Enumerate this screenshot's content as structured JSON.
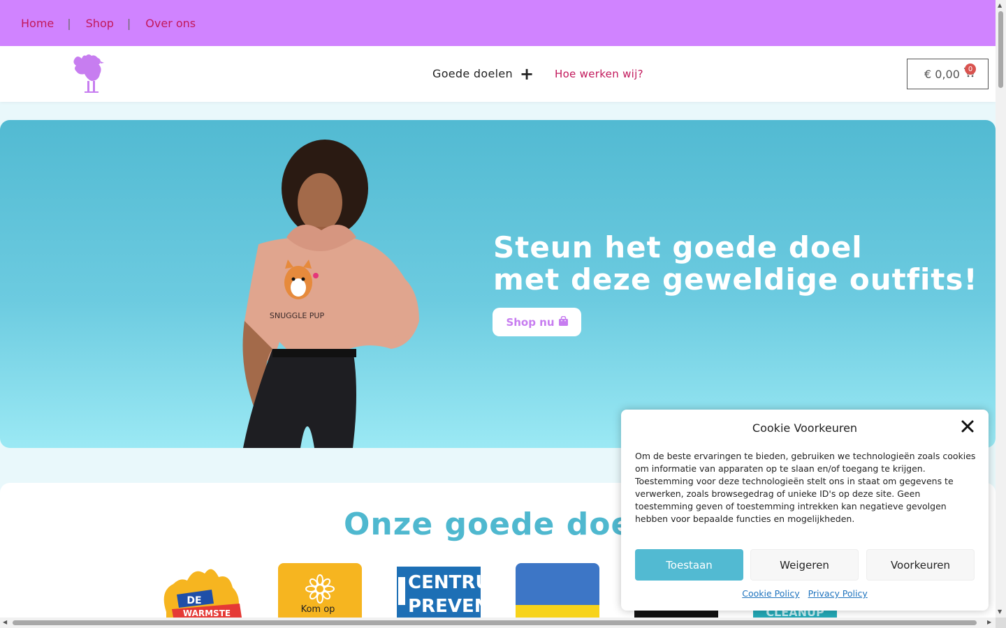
{
  "topbar": {
    "links": [
      {
        "label": "Home"
      },
      {
        "label": "Shop"
      },
      {
        "label": "Over ons"
      }
    ],
    "separator": "|",
    "background": "#d083ff",
    "link_color": "#c2185b"
  },
  "header": {
    "nav_goede_doelen": "Goede doelen",
    "nav_goede_doelen_icon": "plus-icon",
    "nav_hoe_werken": "Hoe werken wij?",
    "cart_total": "€ 0,00",
    "cart_count": "0",
    "cart_icon": "shopping-cart-icon"
  },
  "hero": {
    "title_line1": "Steun het goede doel",
    "title_line2": "met deze geweldige outfits!",
    "shop_button": "Shop nu",
    "shop_button_icon": "shopping-bag-icon",
    "hoodie_text": "SNUGGLE PUP"
  },
  "section": {
    "title": "Onze goede doelen",
    "logos": [
      {
        "name": "de-warmste",
        "text": "DE WARMSTE"
      },
      {
        "name": "kom-op",
        "text": "Kom op"
      },
      {
        "name": "centrum-preventie",
        "text": "CENTRU PREVEN"
      },
      {
        "name": "ukraine",
        "text": ""
      },
      {
        "name": "dark-logo",
        "text": ""
      },
      {
        "name": "cleanup",
        "text": "CLEANUP"
      }
    ]
  },
  "cookie": {
    "title": "Cookie Voorkeuren",
    "text": "Om de beste ervaringen te bieden, gebruiken we technologieën zoals cookies om informatie van apparaten op te slaan en/of toegang te krijgen. Toestemming voor deze technologieën stelt ons in staat om gegevens te verwerken, zoals browsegedrag of unieke ID's op deze site. Geen toestemming geven of toestemming intrekken kan negatieve gevolgen hebben voor bepaalde functies en mogelijkheden.",
    "accept": "Toestaan",
    "deny": "Weigeren",
    "preferences": "Voorkeuren",
    "cookie_policy": "Cookie Policy",
    "privacy_policy": "Privacy Policy"
  },
  "colors": {
    "accent_teal": "#52bad2",
    "brand_purple": "#d083ff",
    "link_pink": "#c2185b"
  }
}
